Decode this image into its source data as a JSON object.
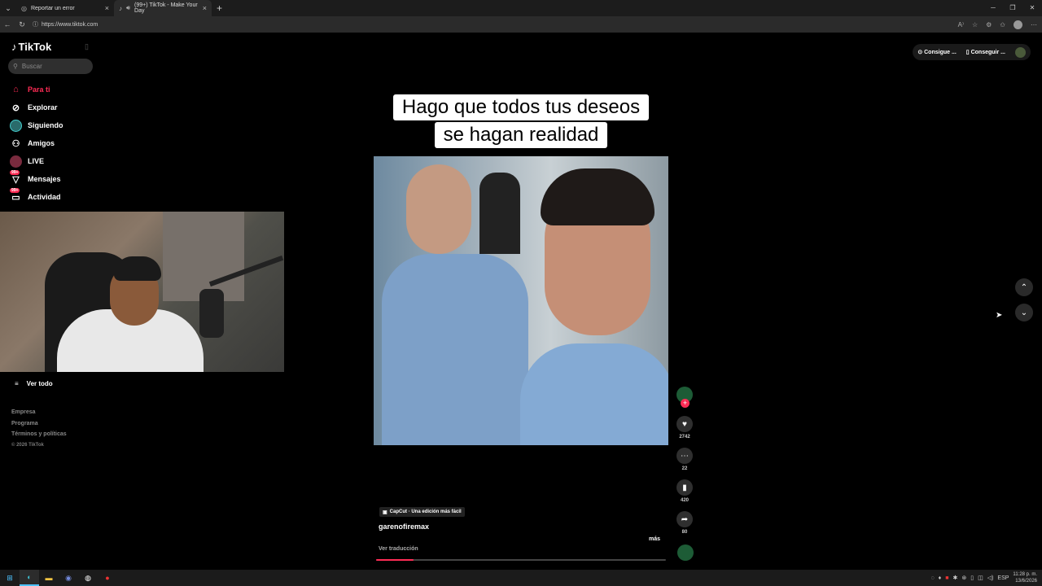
{
  "browser": {
    "tabs": [
      {
        "title": "Reportar un error",
        "active": false
      },
      {
        "title": "(99+) TikTok - Make Your Day",
        "active": true
      }
    ],
    "url": "https://www.tiktok.com"
  },
  "sidebar": {
    "logo": "TikTok",
    "search_placeholder": "Buscar",
    "items": [
      {
        "label": "Para ti",
        "icon": "home-icon",
        "active": true
      },
      {
        "label": "Explorar",
        "icon": "compass-icon"
      },
      {
        "label": "Siguiendo",
        "icon": "following-avatar-icon"
      },
      {
        "label": "Amigos",
        "icon": "friends-icon"
      },
      {
        "label": "LIVE",
        "icon": "live-icon"
      },
      {
        "label": "Mensajes",
        "icon": "messages-icon",
        "badge": "99+"
      },
      {
        "label": "Actividad",
        "icon": "activity-icon",
        "badge": "99+"
      }
    ],
    "see_all": "Ver todo",
    "footer": {
      "links": [
        "Empresa",
        "Programa",
        "Términos y políticas"
      ],
      "copyright": "© 2026 TikTok"
    }
  },
  "header": {
    "get_coins": "Consigue ...",
    "get_app": "Conseguir ..."
  },
  "video": {
    "caption_line1": "Hago que todos tus deseos",
    "caption_line2": "se hagan realidad",
    "capcut_label": "CapCut · Una edición más fácil",
    "author": "garenofiremax",
    "more": "más",
    "translate": "Ver traducción",
    "progress": 0.13,
    "likes": "2742",
    "comments": "22",
    "saves": "420",
    "shares": "80"
  },
  "taskbar": {
    "lang": "ESP",
    "time": "11:28 p. m.",
    "date": "13/6/2026"
  },
  "colors": {
    "accent": "#fe2c55",
    "background": "#000000"
  }
}
